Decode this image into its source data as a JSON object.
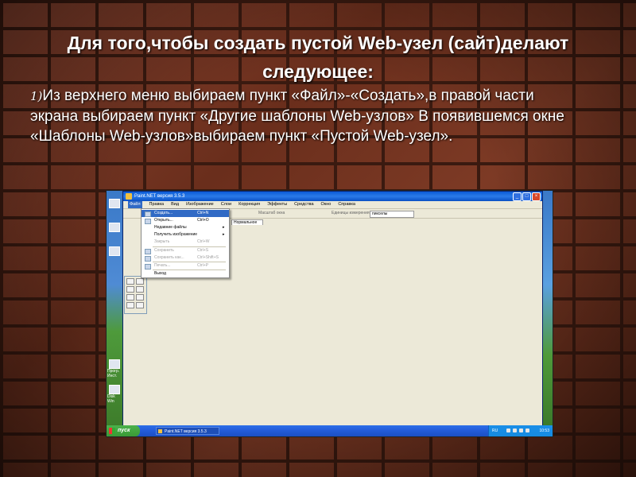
{
  "slide": {
    "title": "Для того,чтобы создать пустой Web-узел (сайт)делают следующее:",
    "body_number": "1)",
    "body": "Из верхнего меню выбираем пункт «Файл»-«Создать»,в правой части экрана выбираем пункт «Другие шаблоны Web-узлов» В появившемся окне «Шаблоны Web-узлов»выбираем пункт «Пустой Web-узел»."
  },
  "screenshot": {
    "window_title": "Paint.NET версия 3.5.3",
    "menu": [
      "Файл",
      "Правка",
      "Вид",
      "Изображение",
      "Слои",
      "Коррекция",
      "Эффекты",
      "Средства",
      "Окно",
      "Справка"
    ],
    "toolbar": {
      "zoom_label": "Масштаб окна",
      "units_label": "Единицы измерения",
      "units_value": "пикселы",
      "blend_value": "Нормальное"
    },
    "file_menu": [
      {
        "label": "Создать...",
        "shortcut": "Ctrl+N",
        "state": "selected"
      },
      {
        "label": "Открыть...",
        "shortcut": "Ctrl+O",
        "state": "normal"
      },
      {
        "label": "Недавние файлы",
        "shortcut": "",
        "state": "normal",
        "submenu": true
      },
      {
        "label": "Получить изображение",
        "shortcut": "",
        "state": "normal",
        "submenu": true
      },
      {
        "label": "Закрыть",
        "shortcut": "Ctrl+W",
        "state": "disabled"
      },
      {
        "label": "Сохранить",
        "shortcut": "Ctrl+S",
        "state": "disabled"
      },
      {
        "label": "Сохранить как...",
        "shortcut": "Ctrl+Shift+S",
        "state": "disabled"
      },
      {
        "label": "Печать...",
        "shortcut": "Ctrl+P",
        "state": "disabled"
      },
      {
        "label": "Выход",
        "shortcut": "",
        "state": "normal"
      }
    ],
    "desktop_icons": [
      "Прогр. Инст.",
      "Disk Win"
    ],
    "taskbar": {
      "start_label": "пуск",
      "task_label": "Paint.NET версия 3.5.3",
      "lang": "RU",
      "clock": "10:53"
    }
  }
}
